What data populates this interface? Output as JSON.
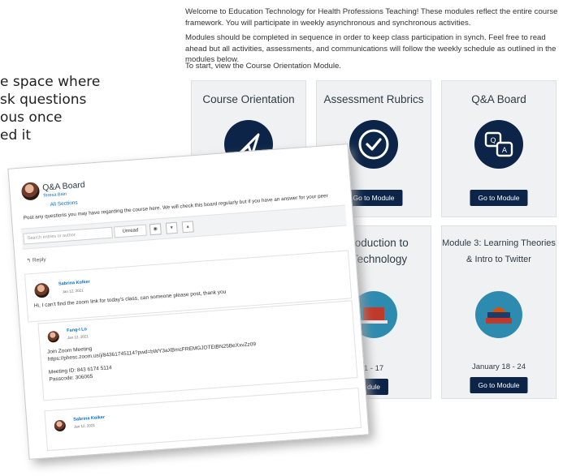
{
  "left_text": {
    "lines": [
      "e space where",
      "sk questions",
      "ous once",
      "ed it"
    ]
  },
  "course": {
    "intro1": "Welcome to Education Technology for Health Professions Teaching!  These modules reflect the entire course framework.  You will participate in weekly asynchronous and synchronous activities.",
    "intro2": "Modules should be completed in sequence in order to keep class participation in synch. Feel free to read ahead but all activities, assessments, and communications will follow the weekly schedule as outlined in the modules below.",
    "intro3": "To start, view the Course Orientation Module.",
    "cards": [
      {
        "title": "Course Orientation",
        "icon": "paper-plane-icon"
      },
      {
        "title": "Assessment Rubrics",
        "icon": "checkmark-circle-icon",
        "button": "Go to Module"
      },
      {
        "title": "Q&A Board",
        "icon": "chat-bubbles-icon",
        "button": "Go to Module"
      },
      {
        "title_line1": "Introduction to",
        "title_line2": "al Technology",
        "icon": "laptop-icon",
        "date": "1 - 17",
        "button": "dule"
      },
      {
        "title_line1": "Module 3: Learning Theories",
        "title_line2": "& Intro to Twitter",
        "icon": "books-icon",
        "date": "January 18 - 24",
        "button": "Go to Module"
      }
    ]
  },
  "board": {
    "title": "Q&A Board",
    "author": "Teresa Bain",
    "sections": "All Sections",
    "description": "Post any questions you may have regarding the course here.  We will check this board regularly but if you have an answer for your peer",
    "search_placeholder": "Search entries or author",
    "unread": "Unread",
    "reply": "Reply",
    "posts": [
      {
        "name": "Sabrina Kolker",
        "time": "Jan 12, 2021",
        "text": "Hi, I can't find the zoom link for today's class, can someone please post, thank you"
      },
      {
        "name": "Fang-I Lo",
        "time": "Jan 12, 2021",
        "lines": [
          "Join Zoom Meeting",
          "https://phesc.zoom.us/j/84361745114?pwd=bWY3aXBmcFREMGJOTEtBN25BeXxvZz09",
          "",
          "Meeting ID: 843 6174 5114",
          "Passcode: 306065"
        ]
      },
      {
        "name": "Sabrina Kolker",
        "time": "Jan 12, 2021"
      }
    ]
  },
  "colors": {
    "navy": "#0c2447",
    "teal": "#2e8bb0",
    "card_bg": "#f0f1f3",
    "link": "#0b6fc5"
  }
}
